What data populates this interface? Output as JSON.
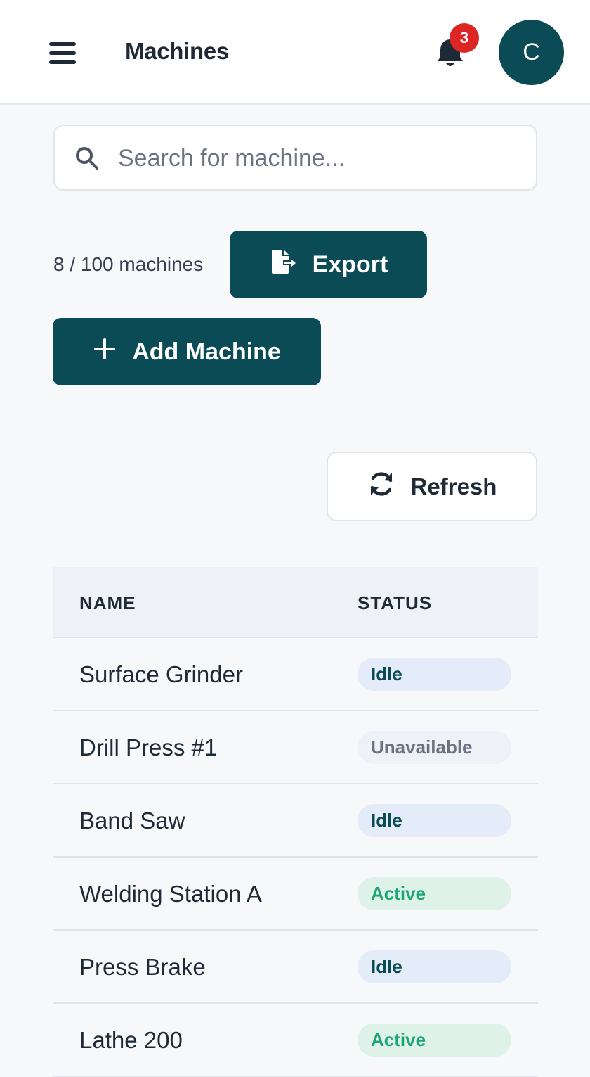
{
  "header": {
    "title": "Machines",
    "notification_count": "3",
    "avatar_initial": "C"
  },
  "search": {
    "placeholder": "Search for machine...",
    "value": ""
  },
  "toolbar": {
    "count_text": "8 / 100 machines",
    "export_label": "Export",
    "add_label": "Add Machine",
    "refresh_label": "Refresh"
  },
  "table": {
    "columns": [
      "NAME",
      "STATUS"
    ],
    "rows": [
      {
        "name": "Surface Grinder",
        "status": "Idle",
        "status_kind": "idle"
      },
      {
        "name": "Drill Press #1",
        "status": "Unavailable",
        "status_kind": "unavailable"
      },
      {
        "name": "Band Saw",
        "status": "Idle",
        "status_kind": "idle"
      },
      {
        "name": "Welding Station A",
        "status": "Active",
        "status_kind": "active"
      },
      {
        "name": "Press Brake",
        "status": "Idle",
        "status_kind": "idle"
      },
      {
        "name": "Lathe 200",
        "status": "Active",
        "status_kind": "active"
      }
    ]
  },
  "colors": {
    "primary": "#0b4b55",
    "badge": "#dc2626",
    "idle_bg": "#e3ecf8",
    "active_text": "#1ea672",
    "unavailable_text": "#6b7280"
  },
  "icons": [
    "menu-icon",
    "bell-icon",
    "search-icon",
    "file-export-icon",
    "plus-icon",
    "refresh-icon"
  ]
}
